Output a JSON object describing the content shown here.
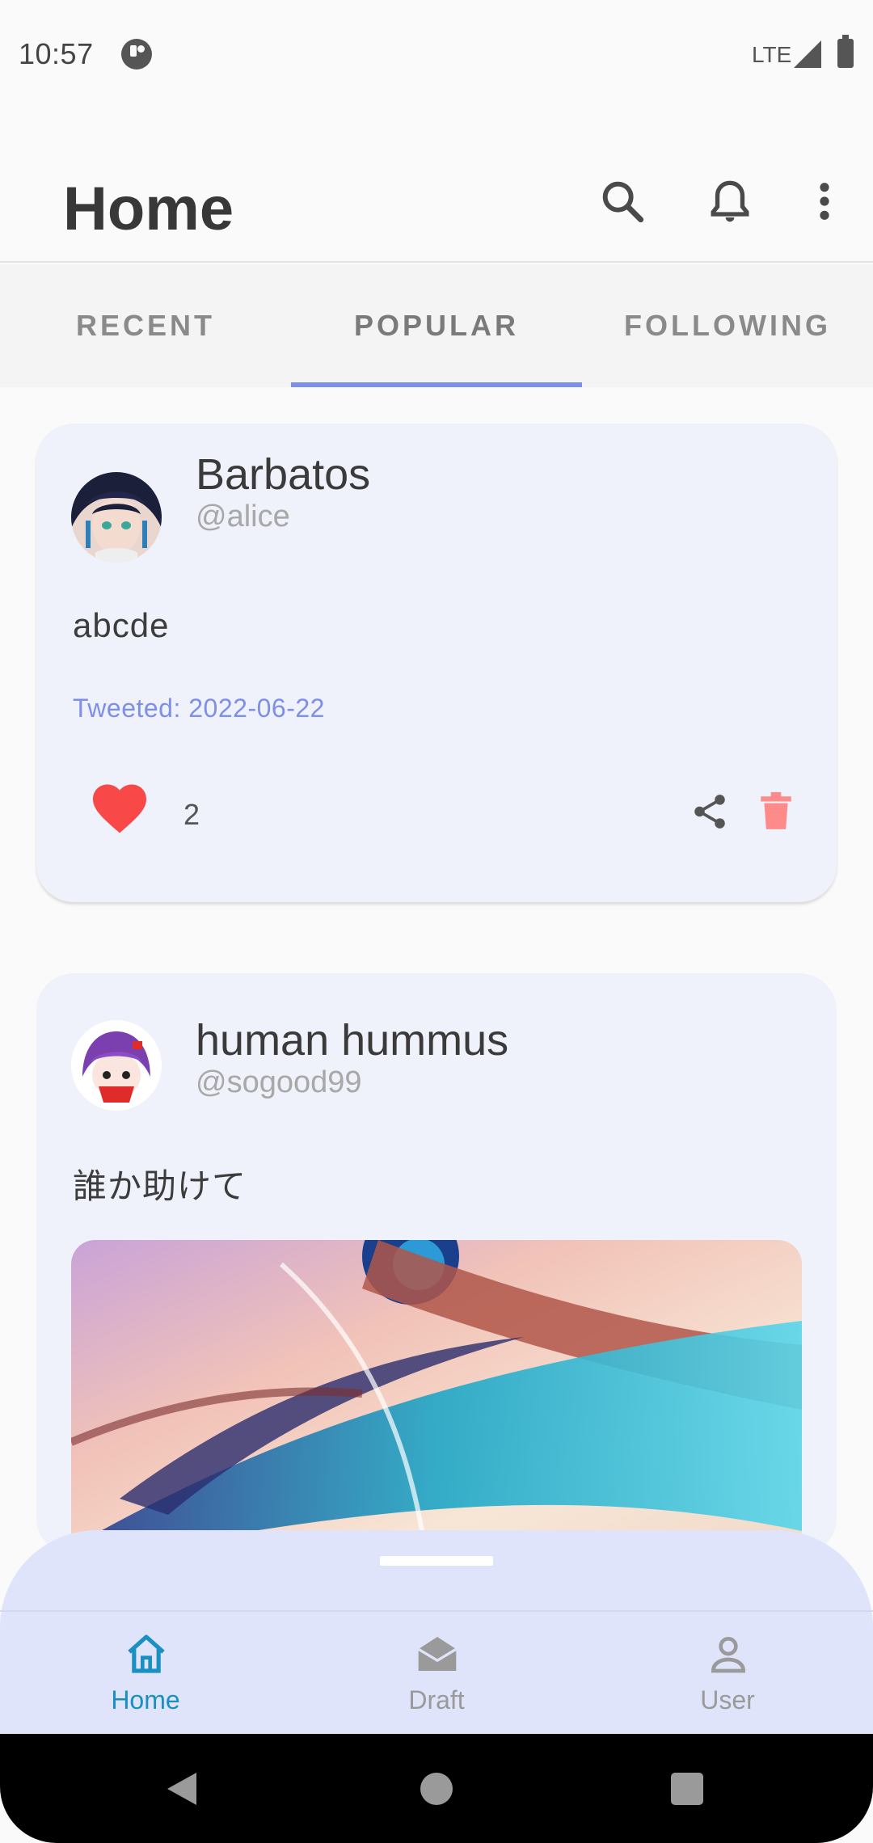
{
  "status_bar": {
    "time": "10:57",
    "network": "LTE"
  },
  "header": {
    "title": "Home"
  },
  "tabs": [
    {
      "label": "RECENT",
      "active": false
    },
    {
      "label": "POPULAR",
      "active": true
    },
    {
      "label": "FOLLOWING",
      "active": false
    }
  ],
  "posts": [
    {
      "author_name": "Barbatos",
      "author_handle": "@alice",
      "text": "abcde",
      "date_label": "Tweeted: 2022-06-22",
      "likes": "2",
      "liked": true
    },
    {
      "author_name": "human hummus",
      "author_handle": "@sogood99",
      "text": "誰か助けて",
      "has_image": true
    }
  ],
  "bottom_nav": [
    {
      "label": "Home",
      "icon": "home-icon",
      "active": true
    },
    {
      "label": "Draft",
      "icon": "draft-icon",
      "active": false
    },
    {
      "label": "User",
      "icon": "user-icon",
      "active": false
    }
  ],
  "colors": {
    "accent": "#7d8fe8",
    "card_bg": "#eff1fb",
    "like": "#f84848",
    "delete": "#ff8a8a",
    "nav_active": "#1a8fc1",
    "nav_inactive": "#9a9a9a",
    "bottom_sheet": "#dfe4fb"
  }
}
